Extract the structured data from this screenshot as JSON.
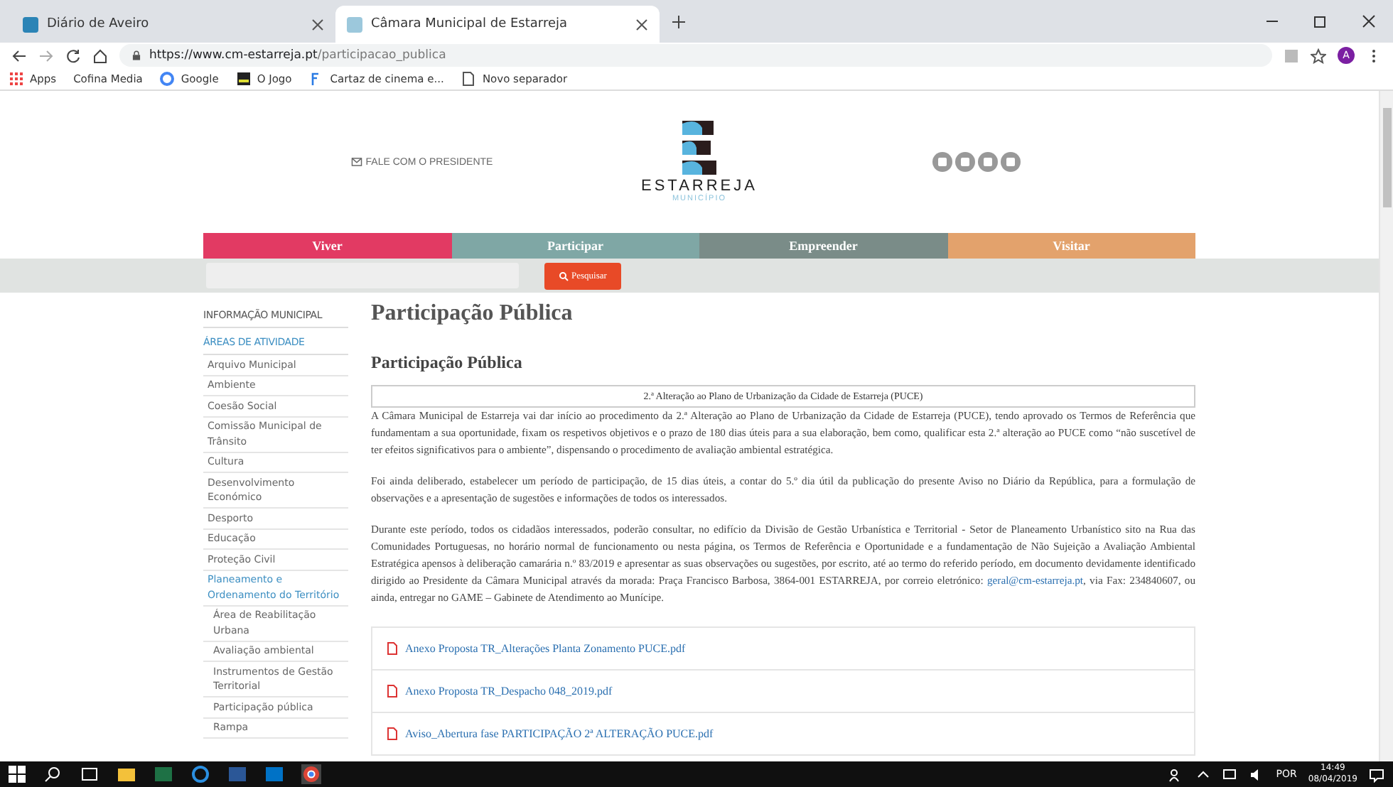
{
  "browser": {
    "tabs": [
      {
        "title": "Diário de Aveiro",
        "selected": false
      },
      {
        "title": "Câmara Municipal de Estarreja",
        "selected": true
      }
    ],
    "url": {
      "host": "https://www.cm-estarreja.pt",
      "path": "/participacao_publica"
    },
    "profile_initial": "A",
    "bookmarks": [
      "Apps",
      "Cofina Media",
      "Google",
      "O Jogo",
      "Cartaz de cinema e...",
      "Novo separador"
    ]
  },
  "header": {
    "contact": "FALE COM O PRESIDENTE",
    "logo_title": "ESTARREJA",
    "logo_subtitle": "MUNICÍPIO"
  },
  "nav": [
    {
      "label": "Viver",
      "color": "#e23a63"
    },
    {
      "label": "Participar",
      "color": "#7fa7a5"
    },
    {
      "label": "Empreender",
      "color": "#7a8c88"
    },
    {
      "label": "Visitar",
      "color": "#e3a26c"
    }
  ],
  "search": {
    "button": "Pesquisar"
  },
  "sidebar": {
    "heading": "INFORMAÇÃO MUNICIPAL",
    "section": "ÁREAS DE ATIVIDADE",
    "items": [
      {
        "label": "Arquivo Municipal",
        "selected": false
      },
      {
        "label": "Ambiente",
        "selected": false
      },
      {
        "label": "Coesão Social",
        "selected": false
      },
      {
        "label": "Comissão Municipal de Trânsito",
        "selected": false
      },
      {
        "label": "Cultura",
        "selected": false
      },
      {
        "label": "Desenvolvimento Económico",
        "selected": false
      },
      {
        "label": "Desporto",
        "selected": false
      },
      {
        "label": "Educação",
        "selected": false
      },
      {
        "label": "Proteção Civil",
        "selected": false
      },
      {
        "label": "Planeamento e Ordenamento do Território",
        "selected": true,
        "children": [
          {
            "label": "Área de Reabilitação Urbana",
            "selected": false
          },
          {
            "label": "Avaliação ambiental",
            "selected": false
          },
          {
            "label": "Instrumentos de Gestão Territorial",
            "selected": false
          },
          {
            "label": "Participação pública",
            "selected": false
          },
          {
            "label": "Rampa",
            "selected": false
          }
        ]
      }
    ]
  },
  "main": {
    "title": "Participação Pública",
    "subtitle": "Participação Pública",
    "notice": "2.ª Alteração ao Plano de Urbanização da Cidade de Estarreja (PUCE)",
    "paragraphs": [
      "A Câmara Municipal de Estarreja vai dar início ao procedimento da 2.ª Alteração ao Plano de Urbanização da Cidade de Estarreja (PUCE), tendo aprovado os Termos de Referência que fundamentam a sua oportunidade, fixam os respetivos objetivos e o prazo de 180 dias úteis para a sua elaboração, bem como, qualificar esta 2.ª alteração ao PUCE como “não suscetível de ter efeitos significativos para o ambiente”, dispensando o procedimento de avaliação ambiental estratégica.",
      "Foi ainda deliberado, estabelecer um período de participação, de 15 dias úteis, a contar do 5.º dia útil da publicação do presente Aviso no Diário da República, para a formulação de observações e a apresentação de sugestões e informações de todos os interessados."
    ],
    "last_paragraph": {
      "before": "Durante este período, todos os cidadãos interessados, poderão consultar, no edifício da Divisão de Gestão Urbanística e Territorial - Setor de Planeamento Urbanístico sito na Rua das Comunidades Portuguesas, no horário normal de funcionamento ou nesta página, os Termos de Referência e Oportunidade e a fundamentação de Não Sujeição a Avaliação Ambiental Estratégica apensos à deliberação camarária n.º 83/2019 e apresentar as suas observações ou sugestões, por escrito, até ao termo do referido período, em documento devidamente identificado dirigido ao Presidente da Câmara Municipal através da morada: Praça Francisco Barbosa, 3864-001 ESTARREJA, por correio eletrónico:",
      "email": "geral@cm-estarreja.pt",
      "after": ", via Fax: 234840607, ou ainda, entregar no GAME – Gabinete de Atendimento ao Munícipe."
    },
    "files": [
      "Anexo Proposta TR_Alterações Planta Zonamento PUCE.pdf",
      "Anexo Proposta TR_Despacho 048_2019.pdf",
      "Aviso_Abertura fase PARTICIPAÇÃO 2ª ALTERAÇÃO PUCE.pdf"
    ]
  },
  "taskbar": {
    "language": "POR",
    "time": "14:49",
    "date": "08/04/2019"
  }
}
